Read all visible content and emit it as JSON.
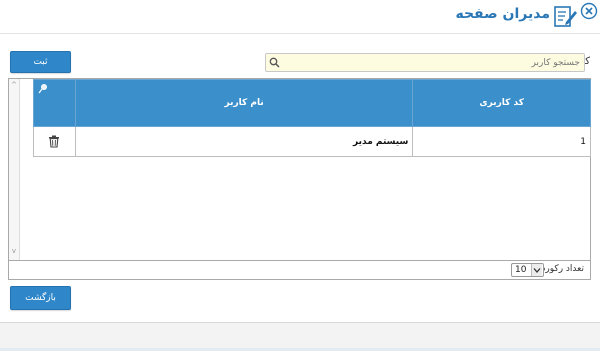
{
  "window": {
    "title": "مدیران صفحه"
  },
  "search": {
    "label": "کاربر :",
    "placeholder": "جستجو کاربر"
  },
  "toolbar": {
    "save_label": "ثبت",
    "back_label": "بازگشت"
  },
  "table": {
    "columns": [
      "کد کاربری",
      "نام کاربر"
    ],
    "rows": [
      {
        "code": "1",
        "name": "سیستم مدیر"
      }
    ]
  },
  "pager": {
    "label": "تعداد رکورد :",
    "page_size": "10"
  },
  "colors": {
    "accent": "#2f86c8",
    "header_bg": "#3b8fcb",
    "title": "#2a77b6"
  },
  "icons": [
    "close-icon",
    "edit-document-icon",
    "search-icon",
    "trash-icon",
    "column-settings-icon",
    "chevron-down-icon"
  ]
}
